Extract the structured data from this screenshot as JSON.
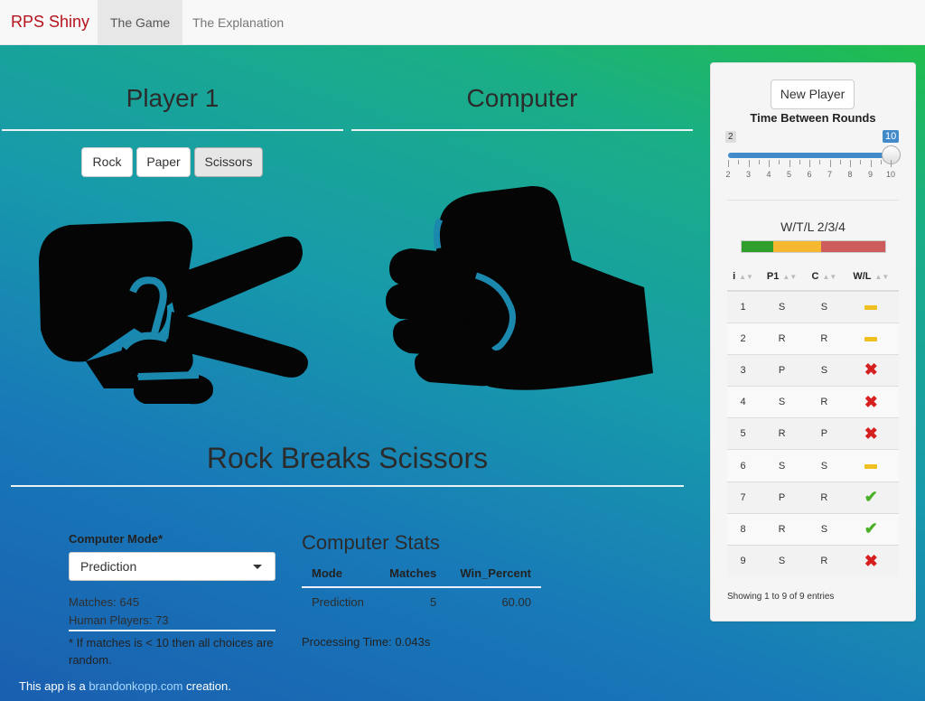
{
  "nav": {
    "brand": "RPS Shiny",
    "tabs": [
      "The Game",
      "The Explanation"
    ],
    "active_tab": "The Game"
  },
  "headings": {
    "player": "Player 1",
    "computer": "Computer"
  },
  "choices": {
    "rock": "Rock",
    "paper": "Paper",
    "scissors": "Scissors",
    "selected": "Scissors"
  },
  "hands": {
    "player": "scissors-hand-icon",
    "computer": "rock-fist-icon"
  },
  "result": "Rock Breaks Scissors",
  "computer_mode": {
    "label": "Computer Mode*",
    "selected": "Prediction",
    "matches": "Matches: 645",
    "human_players": "Human Players: 73",
    "note": "* If matches is < 10 then all choices are random."
  },
  "stats": {
    "title": "Computer Stats",
    "columns": [
      "Mode",
      "Matches",
      "Win_Percent"
    ],
    "rows": [
      [
        "Prediction",
        "5",
        "60.00"
      ]
    ],
    "processing_time": "Processing Time: 0.043s"
  },
  "footer": {
    "prefix": "This app is a ",
    "link": "brandonkopp.com",
    "suffix": " creation."
  },
  "sidebar": {
    "new_player": "New Player",
    "slider": {
      "label": "Time Between Rounds",
      "min": 2,
      "max": 10,
      "value": 10,
      "ticks": [
        "2",
        "3",
        "4",
        "5",
        "6",
        "7",
        "8",
        "9",
        "10"
      ]
    },
    "wtl": {
      "label": "W/T/L 2/3/4",
      "wins": 2,
      "ties": 3,
      "losses": 4,
      "colors": {
        "win": "#2f9e2a",
        "tie": "#f5b82e",
        "loss": "#cd5c5c"
      }
    },
    "table": {
      "columns": [
        "i",
        "P1",
        "C",
        "W/L"
      ],
      "rows": [
        [
          "1",
          "S",
          "S",
          "tie"
        ],
        [
          "2",
          "R",
          "R",
          "tie"
        ],
        [
          "3",
          "P",
          "S",
          "loss"
        ],
        [
          "4",
          "S",
          "R",
          "loss"
        ],
        [
          "5",
          "R",
          "P",
          "loss"
        ],
        [
          "6",
          "S",
          "S",
          "tie"
        ],
        [
          "7",
          "P",
          "R",
          "win"
        ],
        [
          "8",
          "R",
          "S",
          "win"
        ],
        [
          "9",
          "S",
          "R",
          "loss"
        ]
      ],
      "showing": "Showing 1 to 9 of 9 entries"
    }
  }
}
